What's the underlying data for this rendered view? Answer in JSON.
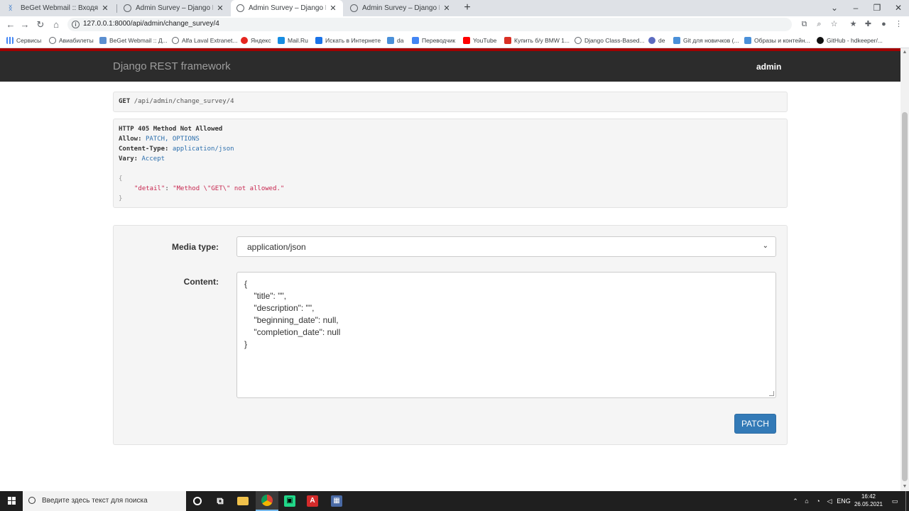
{
  "browser": {
    "tabs": [
      {
        "title": "BeGet Webmail :: Входящие",
        "active": false
      },
      {
        "title": "Admin Survey – Django REST fra",
        "active": false
      },
      {
        "title": "Admin Survey – Django REST fra",
        "active": true
      },
      {
        "title": "Admin Survey – Django REST fra",
        "active": false
      }
    ],
    "new_tab": "+",
    "url": "127.0.0.1:8000/api/admin/change_survey/4",
    "bookmarks": [
      {
        "label": "Сервисы",
        "icon": "apps-grid-icon",
        "color": "#4285f4"
      },
      {
        "label": "Авиабилеты",
        "icon": "globe-icon",
        "color": "#5f6368"
      },
      {
        "label": "BeGet Webmail :: Д...",
        "icon": "beget-icon",
        "color": "#5b8fd0"
      },
      {
        "label": "Alfa Laval Extranet...",
        "icon": "globe-icon",
        "color": "#5f6368"
      },
      {
        "label": "Яндекс",
        "icon": "yandex-icon",
        "color": "#e52620"
      },
      {
        "label": "Mail.Ru",
        "icon": "mailru-icon",
        "color": "#168de2"
      },
      {
        "label": "Искать в Интернете",
        "icon": "search-icon",
        "color": "#1a73e8"
      },
      {
        "label": "da",
        "icon": "bookmark-icon",
        "color": "#4a90d9"
      },
      {
        "label": "Переводчик",
        "icon": "translate-icon",
        "color": "#4285f4"
      },
      {
        "label": "YouTube",
        "icon": "youtube-icon",
        "color": "#ff0000"
      },
      {
        "label": "Купить б/у BMW 1...",
        "icon": "drom-icon",
        "color": "#d93025"
      },
      {
        "label": "Django Class-Based...",
        "icon": "globe-icon",
        "color": "#5f6368"
      },
      {
        "label": "de",
        "icon": "dict-icon",
        "color": "#5c6bc0"
      },
      {
        "label": "Git для новичков (...",
        "icon": "bookmark-icon",
        "color": "#4a90d9"
      },
      {
        "label": "Образы и контейн...",
        "icon": "bookmark-icon",
        "color": "#4a90d9"
      },
      {
        "label": "GitHub - hdkeeper/...",
        "icon": "github-icon",
        "color": "#111111"
      }
    ]
  },
  "navbar": {
    "brand": "Django REST framework",
    "user": "admin"
  },
  "request": {
    "method": "GET",
    "path": "/api/admin/change_survey/4"
  },
  "response": {
    "status_line": "HTTP 405 Method Not Allowed",
    "headers": [
      {
        "name": "Allow:",
        "value": "PATCH, OPTIONS"
      },
      {
        "name": "Content-Type:",
        "value": "application/json"
      },
      {
        "name": "Vary:",
        "value": "Accept"
      }
    ],
    "open_brace": "{",
    "body_key": "\"detail\"",
    "body_colon": ": ",
    "body_value": "\"Method \\\"GET\\\" not allowed.\"",
    "close_brace": "}"
  },
  "form": {
    "media_type_label": "Media type:",
    "media_type_value": "application/json",
    "content_label": "Content:",
    "content_value": "{\n    \"title\": \"\",\n    \"description\": \"\",\n    \"beginning_date\": null,\n    \"completion_date\": null\n}",
    "submit_label": "PATCH"
  },
  "taskbar": {
    "search_placeholder": "Введите здесь текст для поиска",
    "lang": "ENG",
    "time": "16:42",
    "date": "26.05.2021"
  },
  "colors": {
    "navbar_bg": "#2c2c2c",
    "accent_stripe": "#a30000",
    "button_primary": "#337ab7"
  }
}
